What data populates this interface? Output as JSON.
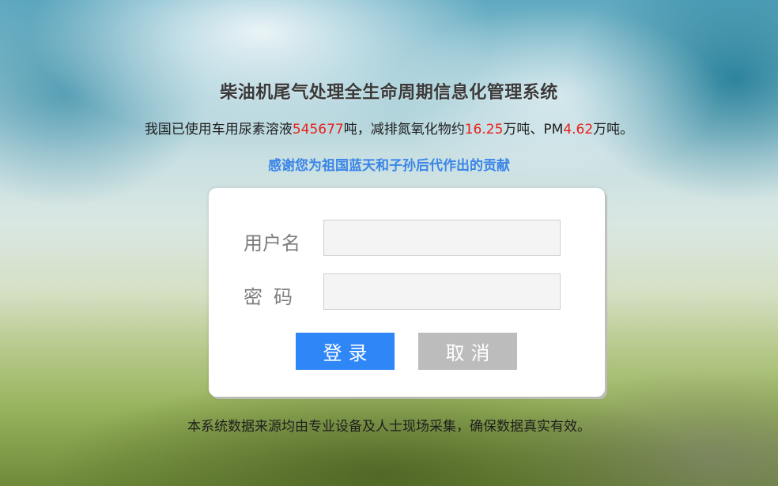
{
  "header": {
    "title": "柴油机尾气处理全生命周期信息化管理系统",
    "stats": {
      "prefix": "我国已使用车用尿素溶液",
      "urea_amount": "545677",
      "mid1": "吨，减排氮氧化物约",
      "nox_amount": "16.25",
      "mid2": "万吨、PM",
      "pm_amount": "4.62",
      "suffix": "万吨。"
    },
    "thanks": "感谢您为祖国蓝天和子孙后代作出的贡献"
  },
  "login": {
    "username_label": "用户名",
    "username_value": "",
    "username_placeholder": "",
    "password_label": "密码",
    "password_value": "",
    "password_placeholder": "",
    "login_button": "登录",
    "cancel_button": "取消"
  },
  "footer": {
    "note": "本系统数据来源均由专业设备及人士现场采集，确保数据真实有效。"
  },
  "colors": {
    "accent_blue": "#2f86f6",
    "highlight_red": "#e8201a",
    "thanks_blue": "#3a85e8",
    "cancel_gray": "#bcbcbc"
  }
}
